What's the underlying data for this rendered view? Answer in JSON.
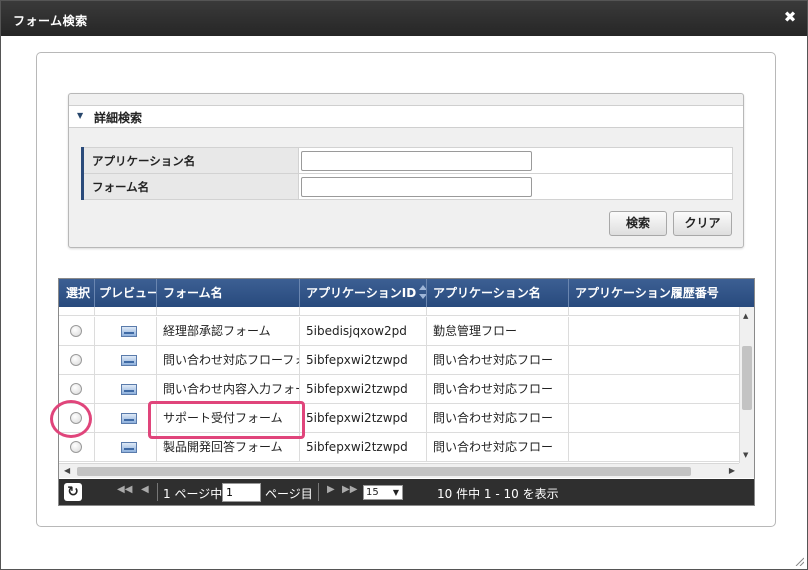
{
  "dialog": {
    "title": "フォーム検索",
    "close_glyph": "✖"
  },
  "search": {
    "header_label": "詳細検索",
    "fields": [
      {
        "label": "アプリケーション名",
        "value": "",
        "placeholder": ""
      },
      {
        "label": "フォーム名",
        "value": "",
        "placeholder": ""
      }
    ],
    "search_button": "検索",
    "clear_button": "クリア"
  },
  "grid": {
    "columns": [
      "選択",
      "プレビュー",
      "フォーム名",
      "アプリケーションID",
      "アプリケーション名",
      "アプリケーション履歴番号"
    ],
    "rows": [
      {
        "form_name": "経理部承認フォーム",
        "app_id": "5ibedisjqxow2pd",
        "app_name": "勤怠管理フロー",
        "history": ""
      },
      {
        "form_name": "問い合わせ対応フローフォーム",
        "app_id": "5ibfepxwi2tzwpd",
        "app_name": "問い合わせ対応フロー",
        "history": ""
      },
      {
        "form_name": "問い合わせ内容入力フォーム",
        "app_id": "5ibfepxwi2tzwpd",
        "app_name": "問い合わせ対応フロー",
        "history": ""
      },
      {
        "form_name": "サポート受付フォーム",
        "app_id": "5ibfepxwi2tzwpd",
        "app_name": "問い合わせ対応フロー",
        "history": ""
      },
      {
        "form_name": "製品開発回答フォーム",
        "app_id": "5ibfepxwi2tzwpd",
        "app_name": "問い合わせ対応フロー",
        "history": ""
      }
    ]
  },
  "pager": {
    "page_prefix": "1 ページ中",
    "page_value": "1",
    "page_suffix": "ページ目",
    "per_page": "15",
    "summary": "10 件中 1 - 10 を表示"
  },
  "colors": {
    "header_blue": "#2f5287",
    "highlight": "#e0457b",
    "pager_bg": "#2f2f2f"
  },
  "icons": [
    "close-icon",
    "collapse-triangle-icon",
    "sort-icon",
    "preview-icon",
    "refresh-icon",
    "first-page-icon",
    "prev-page-icon",
    "next-page-icon",
    "last-page-icon",
    "resize-grip-icon"
  ]
}
